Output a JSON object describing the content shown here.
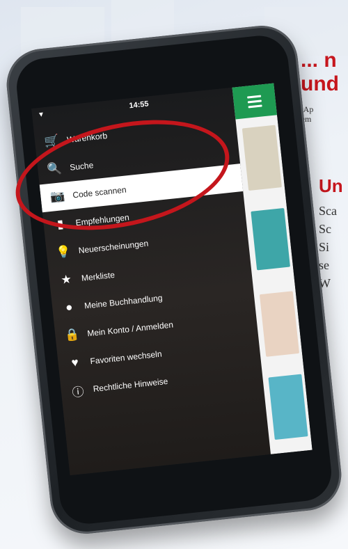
{
  "promo": {
    "headline_line1": "... n",
    "headline_line2": "und",
    "note_line1": "(Die Ap",
    "note_line2": "System",
    "subhead": "Un",
    "body_lines": [
      "Sca",
      "Sc",
      "Si",
      "se",
      "W"
    ]
  },
  "phone": {
    "status_time": "14:55",
    "menu": [
      {
        "label": "Warenkorb",
        "icon": "cart-icon"
      },
      {
        "label": "Suche",
        "icon": "search-icon"
      },
      {
        "label": "Code scannen",
        "icon": "camera-icon"
      },
      {
        "label": "Empfehlungen",
        "icon": "book-icon"
      },
      {
        "label": "Neuerscheinungen",
        "icon": "lightbulb-icon"
      },
      {
        "label": "Merkliste",
        "icon": "star-icon"
      },
      {
        "label": "Meine Buchhandlung",
        "icon": "location-pin-icon"
      },
      {
        "label": "Mein Konto / Anmelden",
        "icon": "lock-icon"
      },
      {
        "label": "Favoriten wechseln",
        "icon": "heart-icon"
      },
      {
        "label": "Rechtliche Hinweise",
        "icon": "info-icon"
      }
    ]
  },
  "colors": {
    "accent_red": "#c6161d",
    "app_green": "#1e9a52"
  }
}
